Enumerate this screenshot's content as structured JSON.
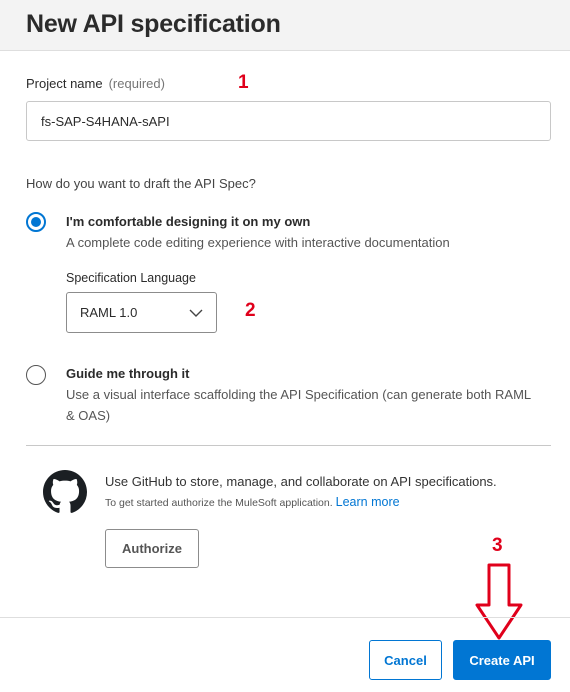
{
  "dialog": {
    "title": "New API specification"
  },
  "project": {
    "label": "Project name",
    "required_hint": "(required)",
    "value": "fs-SAP-S4HANA-sAPI"
  },
  "draft": {
    "question": "How do you want to draft the API Spec?",
    "options": [
      {
        "title": "I'm comfortable designing it on my own",
        "description": "A complete code editing experience with interactive documentation",
        "selected": true
      },
      {
        "title": "Guide me through it",
        "description": "Use a visual interface scaffolding the API Specification (can generate both RAML & OAS)",
        "selected": false
      }
    ],
    "spec_language": {
      "label": "Specification Language",
      "value": "RAML 1.0"
    }
  },
  "github": {
    "icon": "github-icon",
    "main_text": "Use GitHub to store, manage, and collaborate on API specifications.",
    "sub_text": "To get started authorize the MuleSoft application.",
    "learn_more": "Learn more",
    "authorize_label": "Authorize"
  },
  "annotations": {
    "marker_1": "1",
    "marker_2": "2",
    "marker_3": "3",
    "color": "#e0001b"
  },
  "footer": {
    "cancel_label": "Cancel",
    "create_label": "Create API"
  },
  "colors": {
    "accent": "#0176d3",
    "header_bg": "#f3f3f3"
  }
}
